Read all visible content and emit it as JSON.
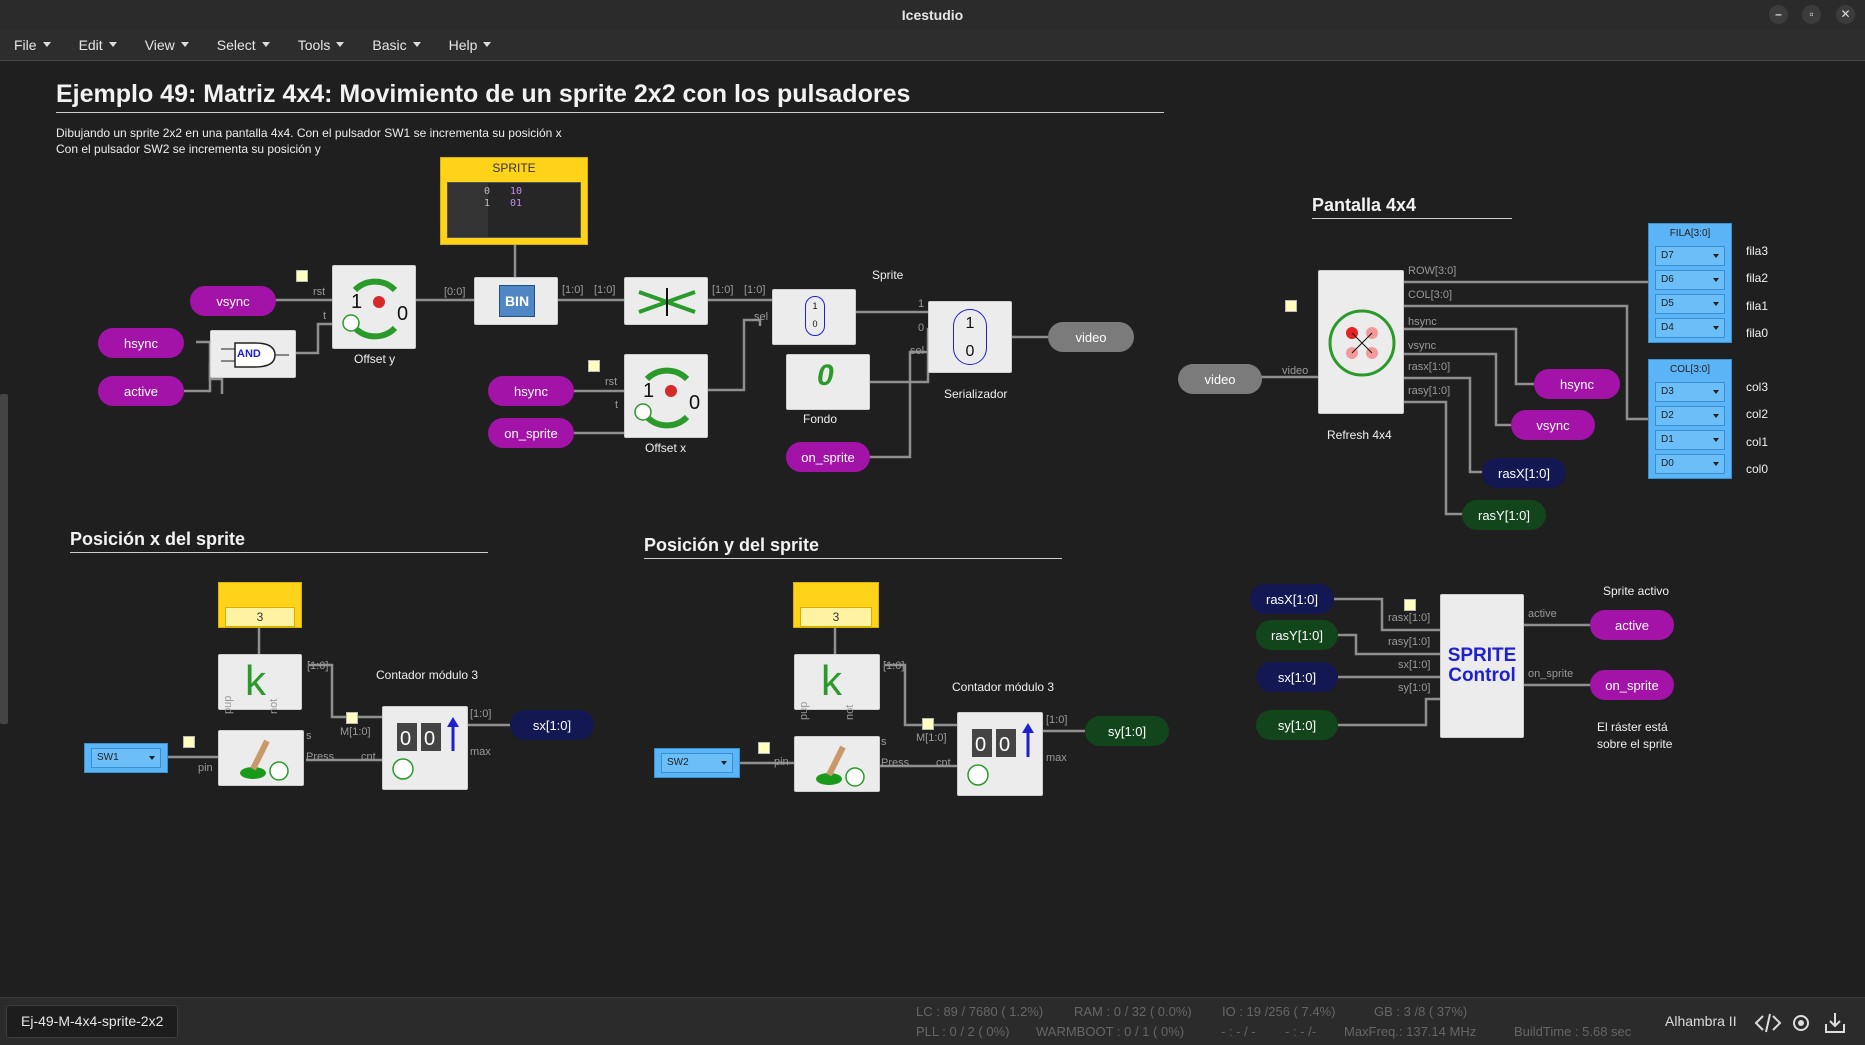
{
  "app": {
    "title": "Icestudio",
    "window_controls": [
      "–",
      "▫",
      "✕"
    ]
  },
  "menu": [
    {
      "label": "File"
    },
    {
      "label": "Edit"
    },
    {
      "label": "View"
    },
    {
      "label": "Select"
    },
    {
      "label": "Tools"
    },
    {
      "label": "Basic"
    },
    {
      "label": "Help"
    }
  ],
  "canvas": {
    "title": "Ejemplo 49: Matriz 4x4: Movimiento de un sprite 2x2 con los pulsadores",
    "desc_line1": "Dibujando un sprite 2x2 en una pantalla 4x4. Con el pulsador SW1 se incrementa su posición x",
    "desc_line2": "Con el pulsador SW2 se incrementa su posición y",
    "sec_pantalla": "Pantalla 4x4",
    "sec_posx": "Posición x del sprite",
    "sec_posy": "Posición y del sprite",
    "sprite_mem": {
      "label": "SPRITE",
      "rows": [
        {
          "addr": "0",
          "val": "10"
        },
        {
          "addr": "1",
          "val": "01"
        }
      ]
    },
    "labels": {
      "sprite": "Sprite",
      "offset_y": "Offset y",
      "offset_x": "Offset x",
      "fondo": "Fondo",
      "serializador": "Serializador",
      "refresh": "Refresh 4x4",
      "contador_x": "Contador módulo 3",
      "contador_y": "Contador módulo 3",
      "sprite_activo": "Sprite activo",
      "raster_1": "El ráster está",
      "raster_2": "sobre el sprite"
    },
    "pills": {
      "vsync": "vsync",
      "hsync": "hsync",
      "active": "active",
      "hsync2": "hsync",
      "on_sprite": "on_sprite",
      "on_sprite2": "on_sprite",
      "video_out": "video",
      "video_in": "video",
      "hsync_out": "hsync",
      "vsync_out": "vsync",
      "rasx_out": "rasX[1:0]",
      "rasy_out": "rasY[1:0]",
      "sx_out": "sx[1:0]",
      "sy_out": "sy[1:0]",
      "rasx_in": "rasX[1:0]",
      "rasy_in": "rasY[1:0]",
      "sx_in": "sx[1:0]",
      "sy_in": "sy[1:0]",
      "active_out": "active",
      "on_sprite_out": "on_sprite"
    },
    "ports": {
      "fila": {
        "header": "FILA[3:0]",
        "pins": [
          "D7",
          "D6",
          "D5",
          "D4"
        ],
        "names": [
          "fila3",
          "fila2",
          "fila1",
          "fila0"
        ]
      },
      "col": {
        "header": "COL[3:0]",
        "pins": [
          "D3",
          "D2",
          "D1",
          "D0"
        ],
        "names": [
          "col3",
          "col2",
          "col1",
          "col0"
        ]
      },
      "sw1": "SW1",
      "sw2": "SW2"
    },
    "consts": {
      "kx": "3",
      "ky": "3"
    },
    "blocks": {
      "and_label": "AND",
      "bin_label": "BIN",
      "sprite_ctrl": "SPRITE\nControl",
      "k": "k"
    },
    "port_labels": {
      "rst": "rst",
      "t": "t",
      "bus_00": "[0:0]",
      "bus_10a": "[1:0]",
      "bus_10b": "[1:0]",
      "bus_10c": "[1:0]",
      "bus_10d": "[1:0]",
      "sel": "sel",
      "sel2": "sel",
      "one": "1",
      "zero": "0",
      "rst2": "rst",
      "t2": "t",
      "row": "ROW[3:0]",
      "col": "COL[3:0]",
      "hsync": "hsync",
      "vsync": "vsync",
      "rasx": "rasx[1:0]",
      "rasy": "rasy[1:0]",
      "video": "video",
      "kx_bus": "[1:0]",
      "ky_bus": "[1:0]",
      "pup": "pup",
      "not": "not",
      "pin": "pin",
      "s": "s",
      "press": "Press",
      "cnt": "cnt",
      "m10": "M[1:0]",
      "cnt_bus": "[1:0]",
      "max": "max",
      "pup2": "pup",
      "not2": "not",
      "pin2": "pin",
      "s2": "s",
      "press2": "Press",
      "cnt2": "cnt",
      "m102": "M[1:0]",
      "cnt_bus2": "[1:0]",
      "max2": "max",
      "sc_active": "active",
      "sc_on_sprite": "on_sprite",
      "sc_rasx": "rasx[1:0]",
      "sc_rasy": "rasy[1:0]",
      "sc_sx": "sx[1:0]",
      "sc_sy": "sy[1:0]"
    }
  },
  "status": {
    "file_tab": "Ej-49-M-4x4-sprite-2x2",
    "lc": "LC : 89 / 7680 ( 1.2%)",
    "ram": "RAM : 0 / 32 ( 0.0%)",
    "io": "IO : 19 /256 ( 7.4%)",
    "gb": "GB : 3 /8 ( 37%)",
    "pll": "PLL : 0 / 2 ( 0%)",
    "warmboot": "WARMBOOT : 0 / 1 ( 0%)",
    "dash1": "- : - / -",
    "dash2": "- : - /-",
    "maxfreq": "MaxFreq.: 137.14 MHz",
    "buildtime": "BuildTime : 5.68 sec",
    "board": "Alhambra II"
  },
  "colors": {
    "magenta": "#a313a8",
    "navy": "#141852",
    "dark_green": "#12451b",
    "port_blue": "#5ab4f5",
    "const_yellow": "#ffd31a"
  }
}
